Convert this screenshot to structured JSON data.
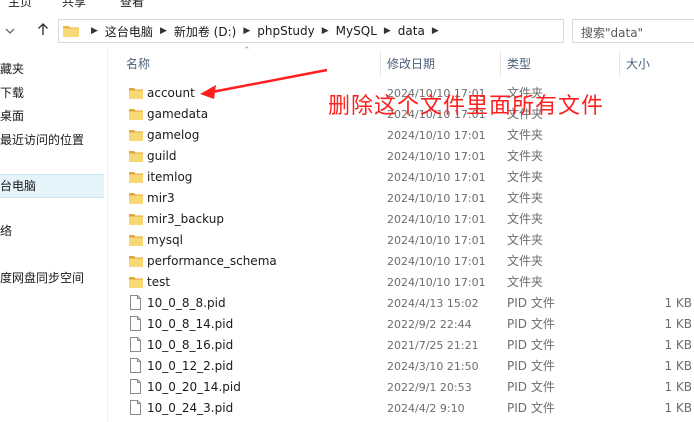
{
  "ribbon": {
    "tabs": [
      "主页",
      "共享",
      "查看"
    ]
  },
  "address": {
    "crumbs": [
      "这台电脑",
      "新加卷 (D:)",
      "phpStudy",
      "MySQL",
      "data"
    ],
    "search_placeholder": "搜索\"data\""
  },
  "sidebar": {
    "items": [
      {
        "label": "藏夹"
      },
      {
        "label": "下载"
      },
      {
        "label": "桌面"
      },
      {
        "label": "最近访问的位置"
      },
      {
        "label": "台电脑"
      },
      {
        "label": "络"
      },
      {
        "label": "度网盘同步空间"
      }
    ]
  },
  "columns": {
    "name": "名称",
    "date": "修改日期",
    "type": "类型",
    "size": "大小"
  },
  "files": [
    {
      "name": "account",
      "date": "2024/10/10 17:01",
      "type": "文件夹",
      "size": "",
      "kind": "folder"
    },
    {
      "name": "gamedata",
      "date": "2024/10/10 17:01",
      "type": "文件夹",
      "size": "",
      "kind": "folder"
    },
    {
      "name": "gamelog",
      "date": "2024/10/10 17:01",
      "type": "文件夹",
      "size": "",
      "kind": "folder"
    },
    {
      "name": "guild",
      "date": "2024/10/10 17:01",
      "type": "文件夹",
      "size": "",
      "kind": "folder"
    },
    {
      "name": "itemlog",
      "date": "2024/10/10 17:01",
      "type": "文件夹",
      "size": "",
      "kind": "folder"
    },
    {
      "name": "mir3",
      "date": "2024/10/10 17:01",
      "type": "文件夹",
      "size": "",
      "kind": "folder"
    },
    {
      "name": "mir3_backup",
      "date": "2024/10/10 17:01",
      "type": "文件夹",
      "size": "",
      "kind": "folder"
    },
    {
      "name": "mysql",
      "date": "2024/10/10 17:01",
      "type": "文件夹",
      "size": "",
      "kind": "folder"
    },
    {
      "name": "performance_schema",
      "date": "2024/10/10 17:01",
      "type": "文件夹",
      "size": "",
      "kind": "folder"
    },
    {
      "name": "test",
      "date": "2024/10/10 17:01",
      "type": "文件夹",
      "size": "",
      "kind": "folder"
    },
    {
      "name": "10_0_8_8.pid",
      "date": "2024/4/13 15:02",
      "type": "PID 文件",
      "size": "1 KB",
      "kind": "file"
    },
    {
      "name": "10_0_8_14.pid",
      "date": "2022/9/2 22:44",
      "type": "PID 文件",
      "size": "1 KB",
      "kind": "file"
    },
    {
      "name": "10_0_8_16.pid",
      "date": "2021/7/25 21:21",
      "type": "PID 文件",
      "size": "1 KB",
      "kind": "file"
    },
    {
      "name": "10_0_12_2.pid",
      "date": "2024/3/10 21:50",
      "type": "PID 文件",
      "size": "1 KB",
      "kind": "file"
    },
    {
      "name": "10_0_20_14.pid",
      "date": "2022/9/1 20:53",
      "type": "PID 文件",
      "size": "1 KB",
      "kind": "file"
    },
    {
      "name": "10_0_24_3.pid",
      "date": "2024/4/2 9:10",
      "type": "PID 文件",
      "size": "1 KB",
      "kind": "file"
    }
  ],
  "annotation": {
    "text": "删除这个文件里面所有文件",
    "color": "#ff1f1f"
  },
  "colors": {
    "folder": "#f8d775",
    "selected": "#e5f3fb"
  }
}
